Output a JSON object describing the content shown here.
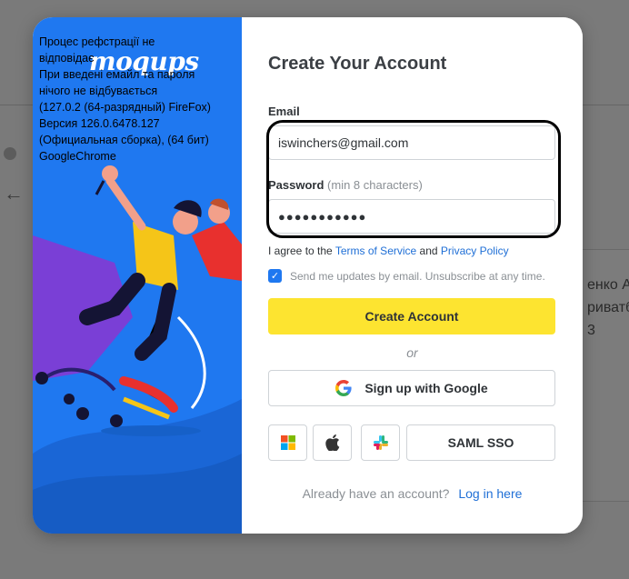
{
  "background": {
    "side_lines": [
      "енко А",
      "риватб",
      "3"
    ]
  },
  "brand": {
    "name": "moqups"
  },
  "form": {
    "title": "Create Your Account",
    "email_label": "Email",
    "email_value": "iswinchers@gmail.com",
    "password_label": "Password",
    "password_hint": "(min 8 characters)",
    "password_value": "●●●●●●●●●●●",
    "agree_prefix": "I agree to the",
    "terms_link": "Terms of Service",
    "agree_and": "and",
    "privacy_link": "Privacy Policy",
    "updates_text": "Send me updates by email. Unsubscribe at any time.",
    "updates_checked": true,
    "create_button": "Create Account",
    "or_text": "or",
    "google_button": "Sign up with Google",
    "saml_button": "SAML SSO",
    "already_text": "Already have an account?",
    "login_link": "Log in here"
  },
  "overlay_note": {
    "lines": [
      "Процес рефстрації не",
      "відповідає",
      "При введені емайл та пароля",
      "нічого не вiдбувається",
      "(127.0.2 (64-разрядный) FireFox)",
      "Версия 126.0.6478.127",
      "(Официальная сборка), (64 бит)",
      "GoogleChrome"
    ]
  },
  "colors": {
    "accent_blue": "#1f78f0",
    "button_yellow": "#fde430",
    "link_blue": "#1f6fd6"
  },
  "icons": [
    "back-arrow-icon",
    "google-icon",
    "microsoft-icon",
    "apple-icon",
    "slack-icon",
    "checkmark-icon"
  ]
}
